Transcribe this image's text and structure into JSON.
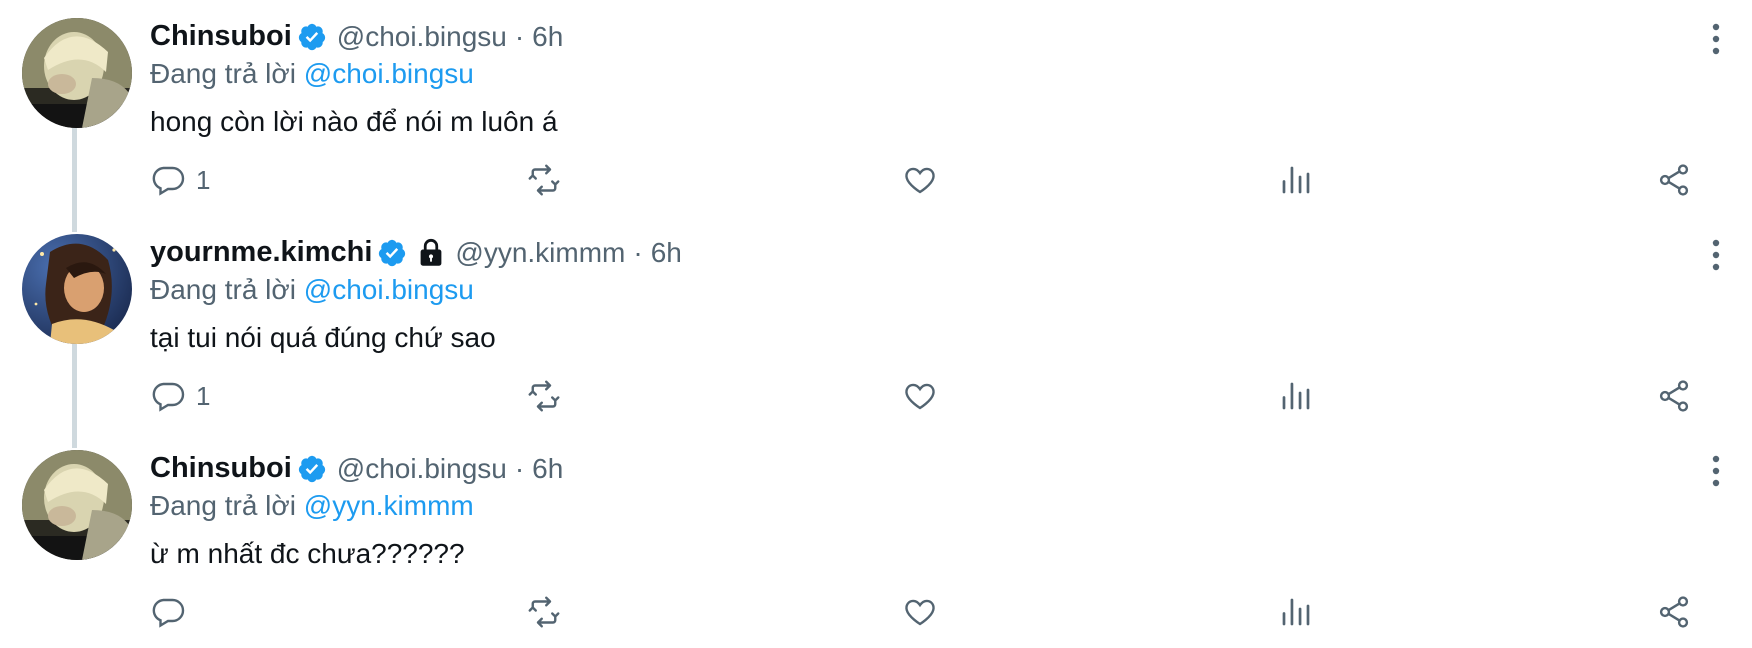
{
  "colors": {
    "link": "#1d9bf0",
    "muted": "#536471",
    "text": "#0f1419",
    "verified": "#1d9bf0"
  },
  "tweets": [
    {
      "name": "Chinsuboi",
      "handle": "@choi.bingsu",
      "separator": "·",
      "time": "6h",
      "reply_prefix": "Đang trả lời",
      "reply_to": "@choi.bingsu",
      "text": "hong còn lời nào để nói m luôn á",
      "reply_count": "1",
      "verified": true,
      "has_lock": false,
      "avatar_icon": "avatar-photo"
    },
    {
      "name": "yournme.kimchi",
      "handle": "@yyn.kimmm",
      "separator": "·",
      "time": "6h",
      "reply_prefix": "Đang trả lời",
      "reply_to": "@choi.bingsu",
      "text": "tại tui nói quá đúng chứ sao",
      "reply_count": "1",
      "verified": true,
      "has_lock": true,
      "avatar_icon": "avatar-illustration"
    },
    {
      "name": "Chinsuboi",
      "handle": "@choi.bingsu",
      "separator": "·",
      "time": "6h",
      "reply_prefix": "Đang trả lời",
      "reply_to": "@yyn.kimmm",
      "text": "ừ m nhất đc chưa??????",
      "reply_count": "",
      "verified": true,
      "has_lock": false,
      "avatar_icon": "avatar-photo"
    }
  ]
}
